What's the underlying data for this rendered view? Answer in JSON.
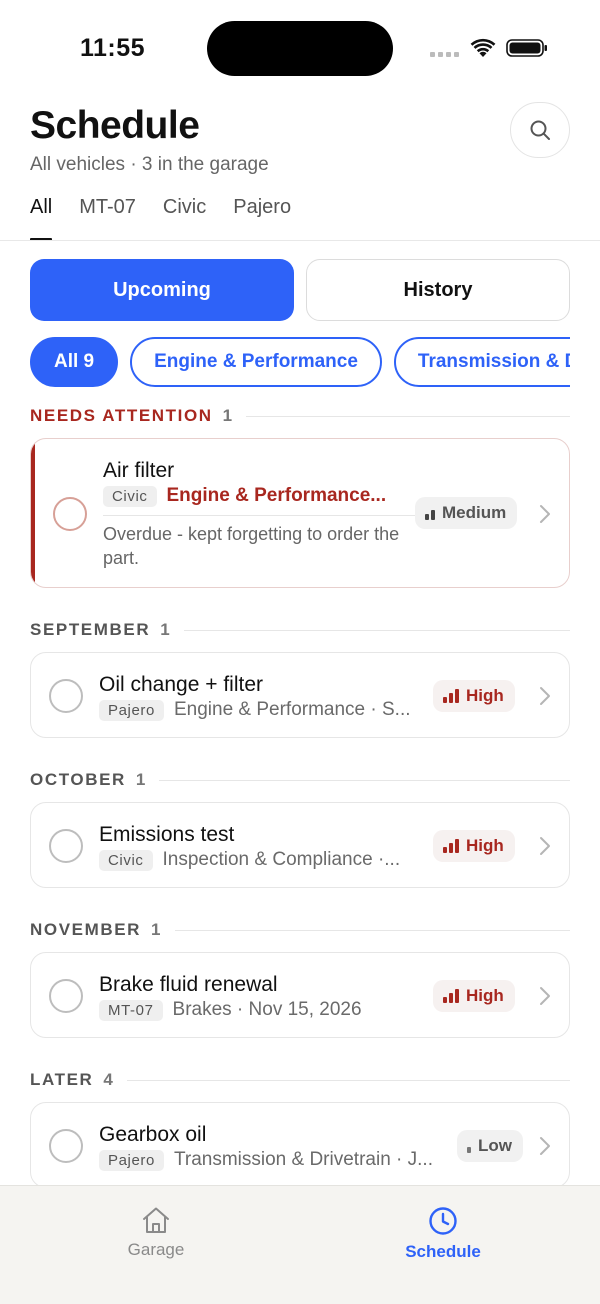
{
  "status_bar": {
    "time": "11:55"
  },
  "header": {
    "title": "Schedule",
    "subtitle": "All vehicles · 3 in the garage"
  },
  "vehicle_tabs": [
    "All",
    "MT-07",
    "Civic",
    "Pajero"
  ],
  "segments": {
    "upcoming": "Upcoming",
    "history": "History"
  },
  "chips": [
    "All 9",
    "Engine & Performance",
    "Transmission & Drivetrain"
  ],
  "sections": {
    "attention": {
      "title": "NEEDS ATTENTION",
      "count": "1"
    },
    "september": {
      "title": "SEPTEMBER",
      "count": "1"
    },
    "october": {
      "title": "OCTOBER",
      "count": "1"
    },
    "november": {
      "title": "NOVEMBER",
      "count": "1"
    },
    "later": {
      "title": "LATER",
      "count": "4"
    }
  },
  "tasks": {
    "air_filter": {
      "title": "Air filter",
      "vehicle": "Civic",
      "category": "Engine & Performance...",
      "note": "Overdue - kept forgetting to order the part.",
      "priority": "Medium"
    },
    "oil_change": {
      "title": "Oil change + filter",
      "vehicle": "Pajero",
      "meta": "Engine & Performance · S...",
      "priority": "High"
    },
    "emissions": {
      "title": "Emissions test",
      "vehicle": "Civic",
      "meta": "Inspection & Compliance ·...",
      "priority": "High"
    },
    "brake_fluid": {
      "title": "Brake fluid renewal",
      "vehicle": "MT-07",
      "meta": "Brakes · Nov 15, 2026",
      "priority": "High"
    },
    "gearbox": {
      "title": "Gearbox oil",
      "vehicle": "Pajero",
      "meta": "Transmission & Drivetrain · J...",
      "priority": "Low"
    }
  },
  "bottom_nav": {
    "garage": "Garage",
    "schedule": "Schedule"
  },
  "colors": {
    "accent": "#2e62f8",
    "alert": "#a8271f"
  }
}
